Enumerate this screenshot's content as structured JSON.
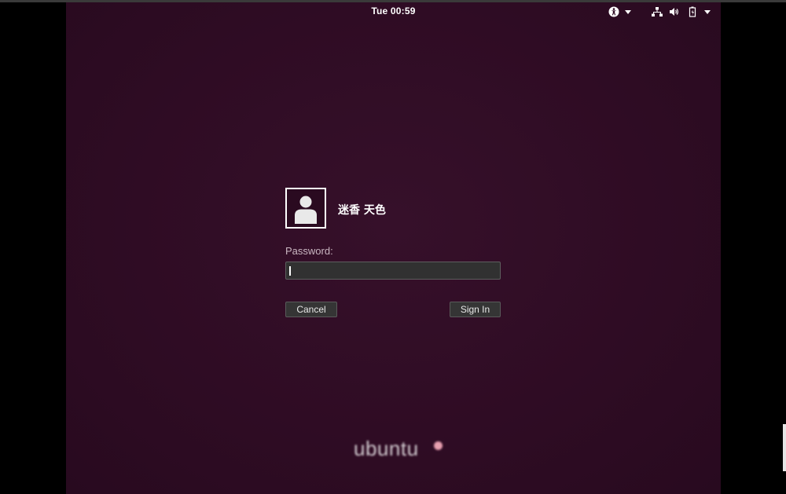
{
  "topbar": {
    "clock": "Tue 00:59",
    "icons": {
      "accessibility": "accessibility-icon",
      "network": "network-icon",
      "volume": "volume-icon",
      "power": "power-icon"
    }
  },
  "login": {
    "username": "迷香 天色",
    "avatar_icon": "user-avatar-icon",
    "password_label": "Password:",
    "password_value": "",
    "cancel_label": "Cancel",
    "sign_in_label": "Sign In"
  },
  "branding": {
    "logo_text": "ubuntu"
  },
  "colors": {
    "background": "#2f0c24",
    "text": "#ffffff",
    "input_bg": "#313131",
    "button_bg": "#353535"
  }
}
